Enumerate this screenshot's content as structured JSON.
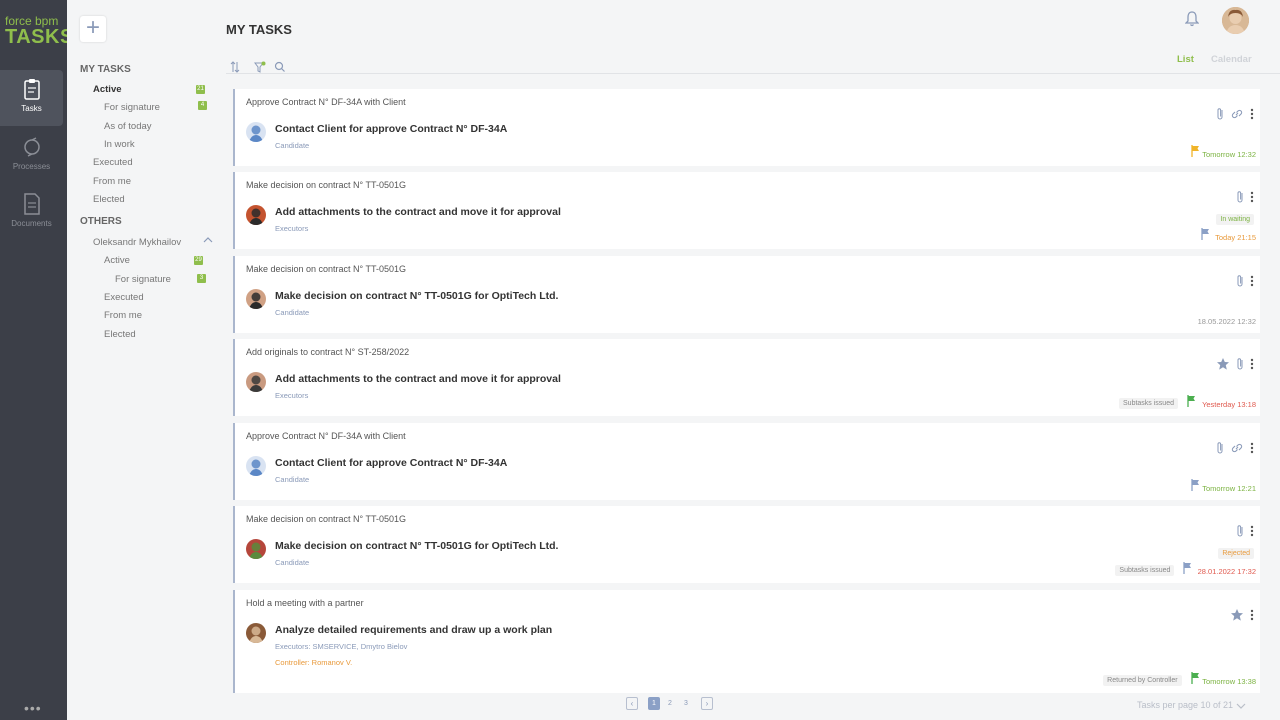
{
  "app": {
    "logo_line1": "force bpm",
    "logo_line2": "TASKS"
  },
  "rail": {
    "items": [
      {
        "label": "Tasks",
        "icon": "clipboard-icon",
        "active": true
      },
      {
        "label": "Processes",
        "icon": "process-icon",
        "active": false
      },
      {
        "label": "Documents",
        "icon": "document-icon",
        "active": false
      }
    ],
    "more": "•••"
  },
  "nav": {
    "add_label": "+",
    "my_tasks": {
      "heading": "MY TASKS",
      "items": [
        {
          "label": "Active",
          "badge": "21"
        },
        {
          "label": "For signature",
          "badge": "4"
        },
        {
          "label": "As of today"
        },
        {
          "label": "In work"
        },
        {
          "label": "Executed"
        },
        {
          "label": "From me"
        },
        {
          "label": "Elected"
        }
      ]
    },
    "others": {
      "heading": "OTHERS",
      "user": "Oleksandr Mykhailov",
      "items": [
        {
          "label": "Active",
          "badge": "29"
        },
        {
          "label": "For signature",
          "badge": "3"
        },
        {
          "label": "Executed"
        },
        {
          "label": "From me"
        },
        {
          "label": "Elected"
        }
      ]
    }
  },
  "header": {
    "title": "MY TASKS",
    "view_tabs": [
      "List",
      "Calendar"
    ],
    "active_view": "List"
  },
  "colors": {
    "accent": "#8fbe4c",
    "link": "#8a9ab8",
    "danger": "#e05a4f",
    "warn": "#e8a33c",
    "ok": "#7cb342"
  },
  "tasks": [
    {
      "parent": "Approve Contract N° DF-34A with Client",
      "title": "Contact Client for approve Contract N° DF-34A",
      "role": "Candidate",
      "due": "Tomorrow 12:32",
      "due_color": "#7cb342",
      "flag_color": "#f0b429",
      "icons": [
        "paperclip-icon",
        "link-icon",
        "more-icon"
      ],
      "status": ""
    },
    {
      "parent": "Make decision on contract N° TT-0501G",
      "title": "Add attachments to the contract and move it for approval",
      "role": "Executors",
      "due": "Today 21:15",
      "due_color": "#e89a3c",
      "flag_color": "#8ba0c6",
      "icons": [
        "paperclip-icon",
        "more-icon"
      ],
      "status": "In waiting",
      "status_color": "#7cb342"
    },
    {
      "parent": "Make decision on contract N° TT-0501G",
      "title": "Make decision on contract N° TT-0501G for OptiTech Ltd.",
      "role": "Candidate",
      "due": "18.05.2022 12:32",
      "due_color": "#999999",
      "flag_color": "",
      "icons": [
        "paperclip-icon",
        "more-icon"
      ],
      "status": ""
    },
    {
      "parent": "Add originals to contract N° ST-258/2022",
      "title": "Add attachments to the contract and move it for approval",
      "role": "Executors",
      "due": "Yesterday 13:18",
      "due_color": "#e05a4f",
      "flag_color": "#4caf50",
      "icons": [
        "star-icon",
        "paperclip-icon",
        "more-icon"
      ],
      "status": "Subtasks issued",
      "status_color": "#888888"
    },
    {
      "parent": "Approve Contract N° DF-34A with Client",
      "title": "Contact Client for approve Contract N° DF-34A",
      "role": "Candidate",
      "due": "Tomorrow 12:21",
      "due_color": "#7cb342",
      "flag_color": "#8ba0c6",
      "icons": [
        "paperclip-icon",
        "link-icon",
        "more-icon"
      ],
      "status": ""
    },
    {
      "parent": "Make decision on contract N° TT-0501G",
      "title": "Make decision on contract N° TT-0501G for OptiTech Ltd.",
      "role": "Candidate",
      "due": "28.01.2022 17:32",
      "due_color": "#e05a4f",
      "flag_color": "#8ba0c6",
      "icons": [
        "paperclip-icon",
        "more-icon"
      ],
      "status": "Subtasks issued",
      "status_color": "#888888",
      "status2": "Rejected",
      "status2_color": "#e89a3c"
    },
    {
      "parent": "Hold a meeting with a partner",
      "title": "Analyze detailed requirements and draw up a work plan",
      "role": "Executors: SMSERVICE, Dmytro Bielov",
      "controller": "Controller:   Romanov V.",
      "due": "Tomorrow 13:38",
      "due_color": "#7cb342",
      "flag_color": "#4caf50",
      "icons": [
        "star-icon",
        "more-icon"
      ],
      "status": "Returned by Controller",
      "status_color": "#888888"
    }
  ],
  "pagination": {
    "pages": [
      "1",
      "2",
      "3"
    ],
    "current": "1",
    "prev": "‹",
    "next": "›",
    "per_page_text": "Tasks per page 10 of 21"
  }
}
